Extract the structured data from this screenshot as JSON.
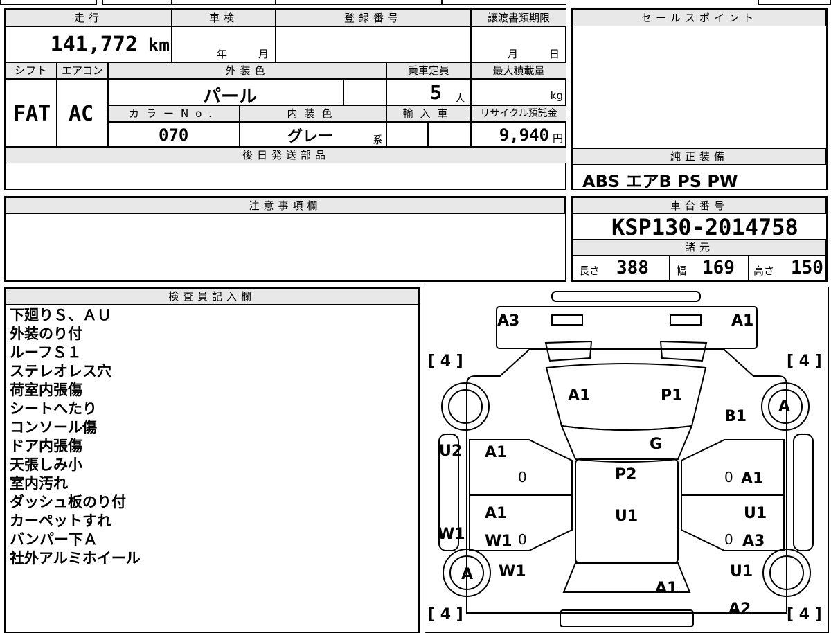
{
  "header": {
    "mileage_label": "走行",
    "mileage_value": "141,772",
    "mileage_unit": "km",
    "inspection_label": "車検",
    "inspection_year": "年",
    "inspection_month": "月",
    "registration_label": "登録番号",
    "transfer_label": "譲渡書類期限",
    "transfer_month": "月",
    "transfer_day": "日",
    "shift_label": "シフト",
    "aircon_label": "エアコン",
    "exterior_label": "外装色",
    "capacity_label": "乗車定員",
    "maxload_label": "最大積載量",
    "shift_value": "FAT",
    "aircon_value": "AC",
    "exterior_value": "パール",
    "capacity_value": "5",
    "capacity_unit": "人",
    "maxload_unit": "kg",
    "color_no_label": "カラーNo.",
    "interior_label": "内装色",
    "import_label": "輸入車",
    "recycle_label": "リサイクル預託金",
    "color_no_value": "070",
    "interior_value": "グレー",
    "interior_suffix": "系",
    "recycle_value": "9,940",
    "recycle_unit": "円",
    "later_parts_label": "後日発送部品"
  },
  "sales": {
    "sales_point_label": "セールスポイント",
    "equipment_label": "純正装備",
    "equipment_value": "ABS エアB PS PW",
    "chassis_label": "車台番号",
    "chassis_value": "KSP130-2014758",
    "specs_label": "諸元",
    "length_label": "長さ",
    "length_value": "388",
    "width_label": "幅",
    "width_value": "169",
    "height_label": "高さ",
    "height_value": "150"
  },
  "notes": {
    "caution_label": "注意事項欄",
    "inspector_label": "検査員記入欄"
  },
  "remarks": [
    "下廻りＳ、ＡＵ",
    "外装のり付",
    "ルーフＳ１",
    "ステレオレス穴",
    "荷室内張傷",
    "シートへたり",
    "コンソール傷",
    "ドア内張傷",
    "天張しみ小",
    "室内汚れ",
    "ダッシュ板のり付",
    "カーペットすれ",
    "バンパー下Ａ",
    "社外アルミホイール"
  ],
  "diagram": {
    "tire_tl": "[ 4 ]",
    "tire_tr": "[ 4 ]",
    "tire_bl": "[ 4 ]",
    "tire_br": "[ 4 ]",
    "marks": {
      "a3_top": "A3",
      "a1_top": "A1",
      "a1_hood": "A1",
      "p1_hood": "P1",
      "b1_fender": "B1",
      "a_wheel_fr": "A",
      "g_windshield": "G",
      "u2_left": "U2",
      "a1_front_left_door": "A1",
      "zero_fl": "0",
      "p2_roof": "P2",
      "zero_fr": "0",
      "a1_front_right_door": "A1",
      "a1_rear_left_door": "A1",
      "u1_roof": "U1",
      "u1_rear_right_door": "U1",
      "w1_left_sill": "W1",
      "w1_rear_left_door": "W1",
      "zero_rl": "0",
      "zero_rr": "0",
      "a3_rear_right_door": "A3",
      "a_wheel_rl": "A",
      "w1_rear_left": "W1",
      "u1_rear_right": "U1",
      "a1_tailgate": "A1",
      "a2_rear_right": "A2"
    }
  }
}
